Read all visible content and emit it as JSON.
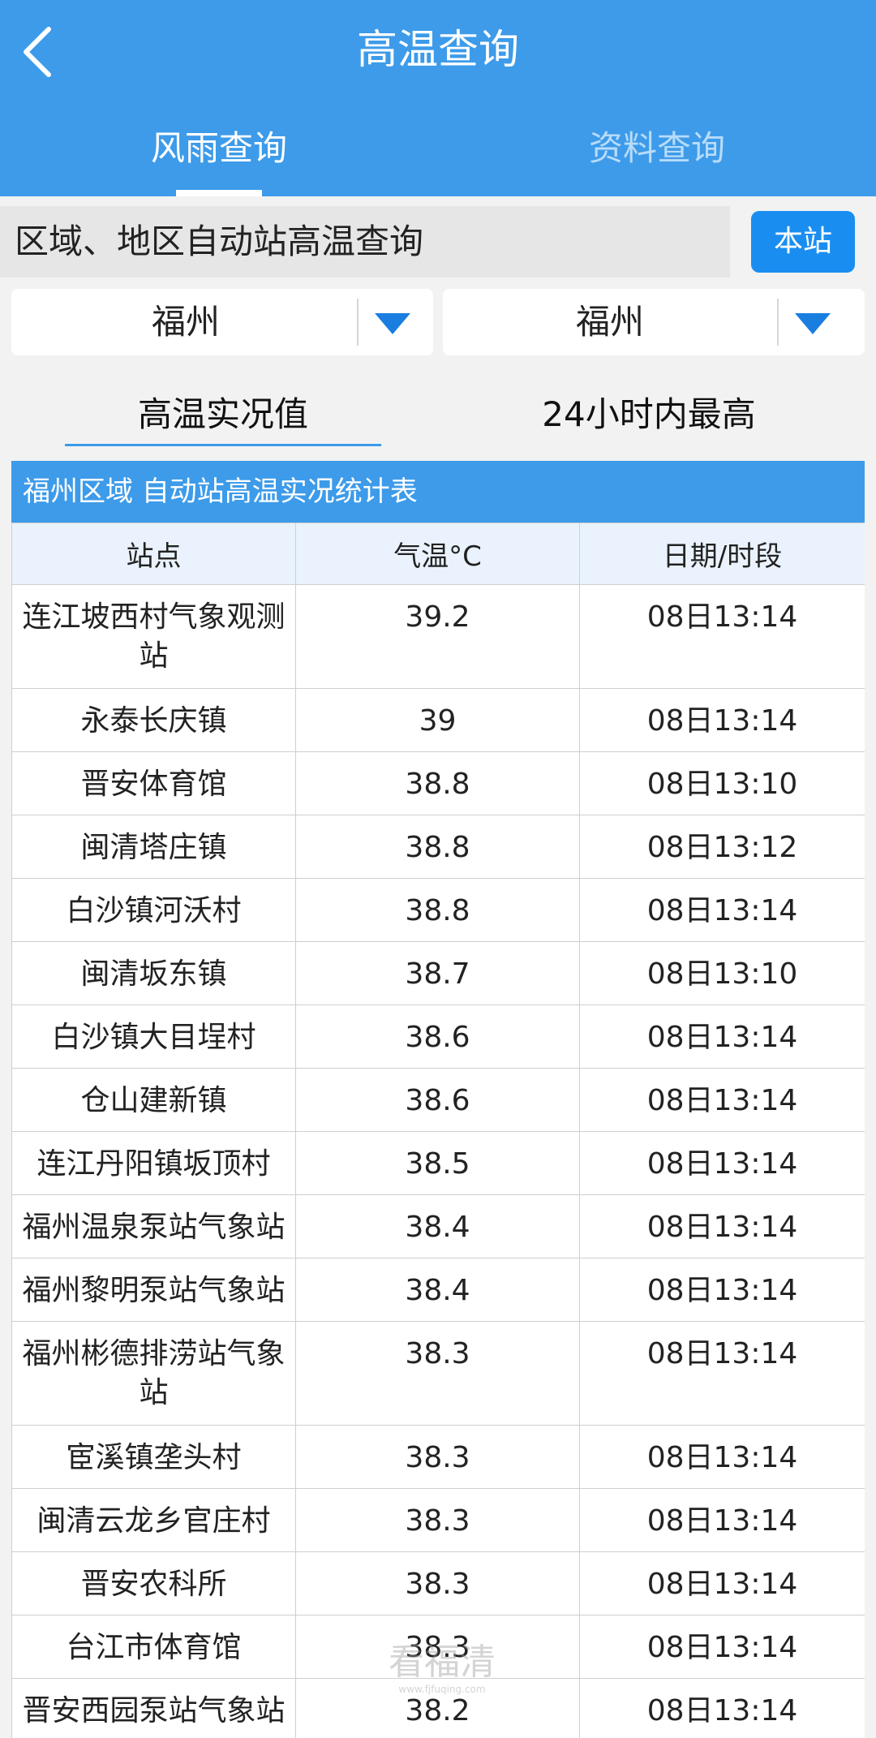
{
  "header": {
    "title": "高温查询",
    "tabs": [
      {
        "label": "风雨查询",
        "active": true
      },
      {
        "label": "资料查询",
        "active": false
      }
    ]
  },
  "query": {
    "label": "区域、地区自动站高温查询",
    "station_button": "本站",
    "select_region": "福州",
    "select_area": "福州"
  },
  "sub_tabs": [
    {
      "label": "高温实况值",
      "active": true
    },
    {
      "label": "24小时内最高",
      "active": false
    }
  ],
  "table": {
    "caption": "福州区域 自动站高温实况统计表",
    "columns": [
      "站点",
      "气温°C",
      "日期/时段"
    ],
    "rows": [
      {
        "station": "连江坡西村气象观测站",
        "temp": "39.2",
        "time": "08日13:14"
      },
      {
        "station": "永泰长庆镇",
        "temp": "39",
        "time": "08日13:14"
      },
      {
        "station": "晋安体育馆",
        "temp": "38.8",
        "time": "08日13:10"
      },
      {
        "station": "闽清塔庄镇",
        "temp": "38.8",
        "time": "08日13:12"
      },
      {
        "station": "白沙镇河沃村",
        "temp": "38.8",
        "time": "08日13:14"
      },
      {
        "station": "闽清坂东镇",
        "temp": "38.7",
        "time": "08日13:10"
      },
      {
        "station": "白沙镇大目埕村",
        "temp": "38.6",
        "time": "08日13:14"
      },
      {
        "station": "仓山建新镇",
        "temp": "38.6",
        "time": "08日13:14"
      },
      {
        "station": "连江丹阳镇坂顶村",
        "temp": "38.5",
        "time": "08日13:14"
      },
      {
        "station": "福州温泉泵站气象站",
        "temp": "38.4",
        "time": "08日13:14"
      },
      {
        "station": "福州黎明泵站气象站",
        "temp": "38.4",
        "time": "08日13:14"
      },
      {
        "station": "福州彬德排涝站气象站",
        "temp": "38.3",
        "time": "08日13:14"
      },
      {
        "station": "宦溪镇垄头村",
        "temp": "38.3",
        "time": "08日13:14"
      },
      {
        "station": "闽清云龙乡官庄村",
        "temp": "38.3",
        "time": "08日13:14"
      },
      {
        "station": "晋安农科所",
        "temp": "38.3",
        "time": "08日13:14"
      },
      {
        "station": "台江市体育馆",
        "temp": "38.3",
        "time": "08日13:14"
      },
      {
        "station": "晋安西园泵站气象站",
        "temp": "38.2",
        "time": "08日13:14"
      }
    ]
  },
  "watermark": {
    "text": "看福清",
    "sub": "www.fjfuqing.com"
  },
  "colors": {
    "header": "#3d9be9",
    "button": "#1a8ef0",
    "dropdown_arrow": "#1a7ee0"
  },
  "icons": {
    "back": "chevron-left-icon",
    "dropdown": "triangle-down-icon"
  }
}
